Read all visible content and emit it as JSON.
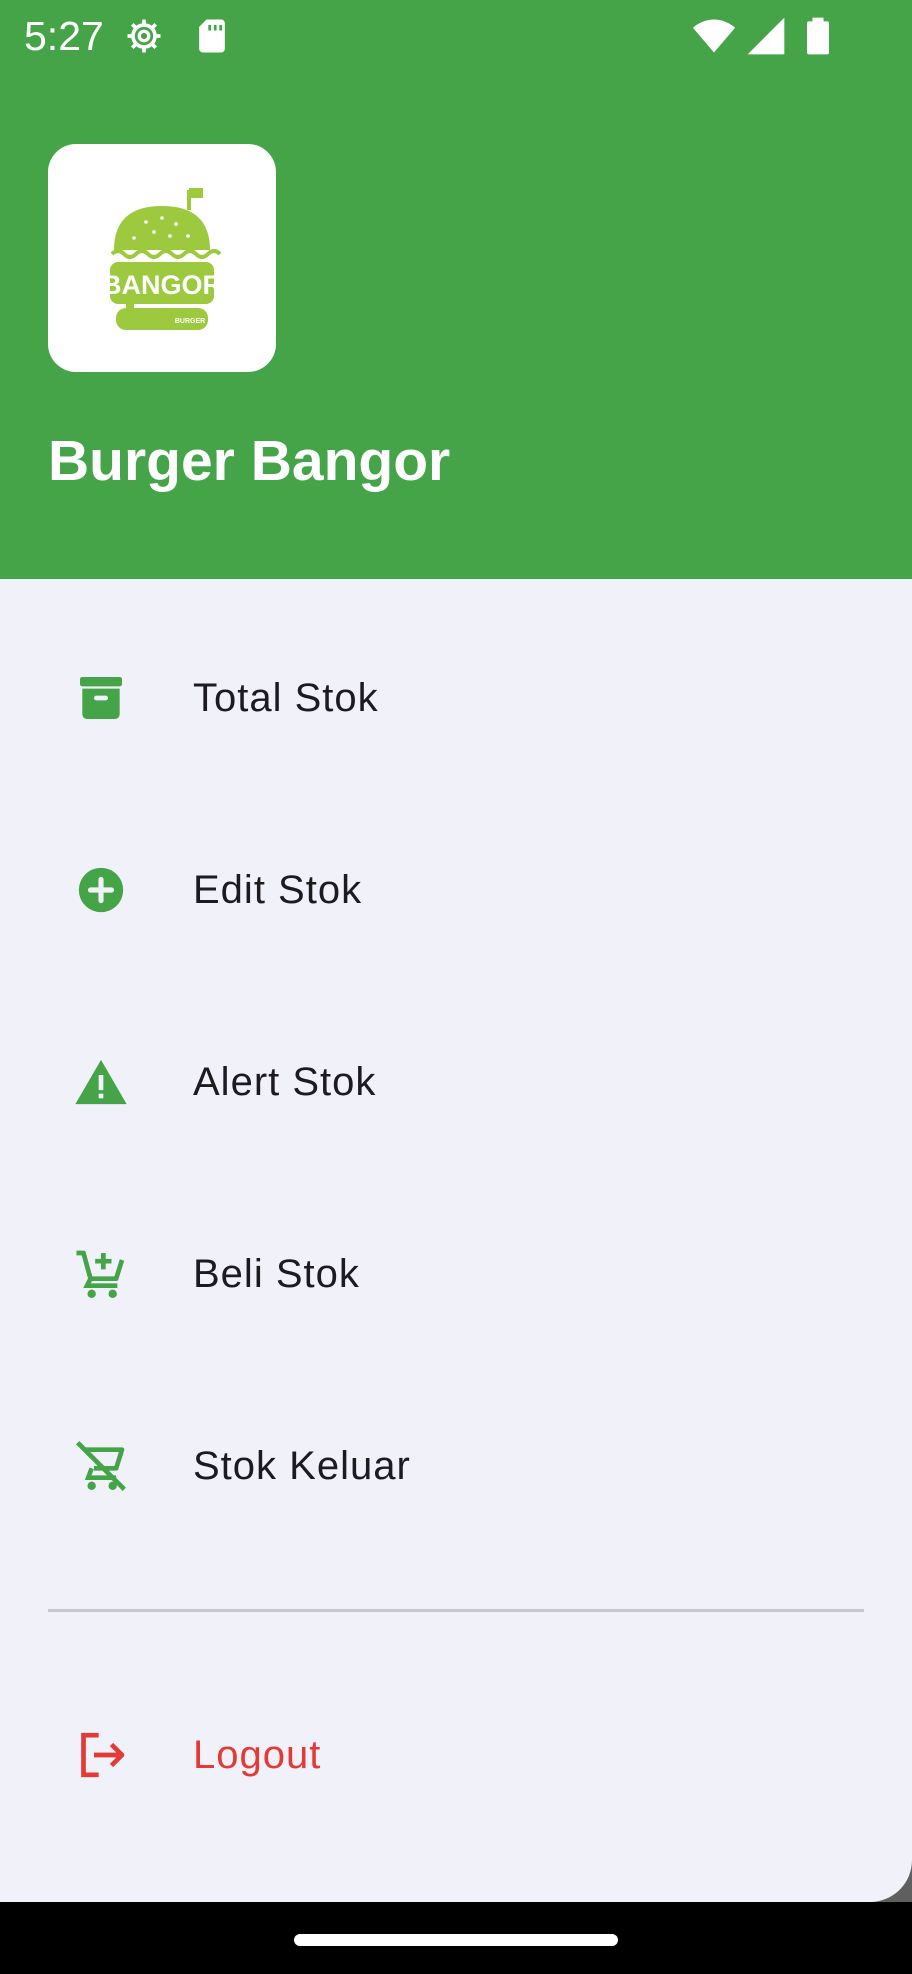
{
  "status_bar": {
    "time": "5:27",
    "icons": [
      "settings-icon",
      "sd-card-icon",
      "wifi-icon",
      "signal-icon",
      "battery-icon"
    ]
  },
  "header": {
    "logo": {
      "icon": "bangor-burger-logo",
      "text_main": "BANGOR",
      "text_sub": "BURGER"
    },
    "title": "Burger Bangor",
    "background_color": "#45a348"
  },
  "menu": {
    "items": [
      {
        "label": "Total Stok",
        "icon": "archive-box-icon"
      },
      {
        "label": "Edit Stok",
        "icon": "add-circle-icon"
      },
      {
        "label": "Alert Stok",
        "icon": "warning-icon"
      },
      {
        "label": "Beli Stok",
        "icon": "add-cart-icon"
      },
      {
        "label": "Stok Keluar",
        "icon": "remove-cart-icon"
      }
    ],
    "logout": {
      "label": "Logout",
      "icon": "logout-icon",
      "color": "#e53935"
    },
    "icon_color": "#45a348"
  }
}
